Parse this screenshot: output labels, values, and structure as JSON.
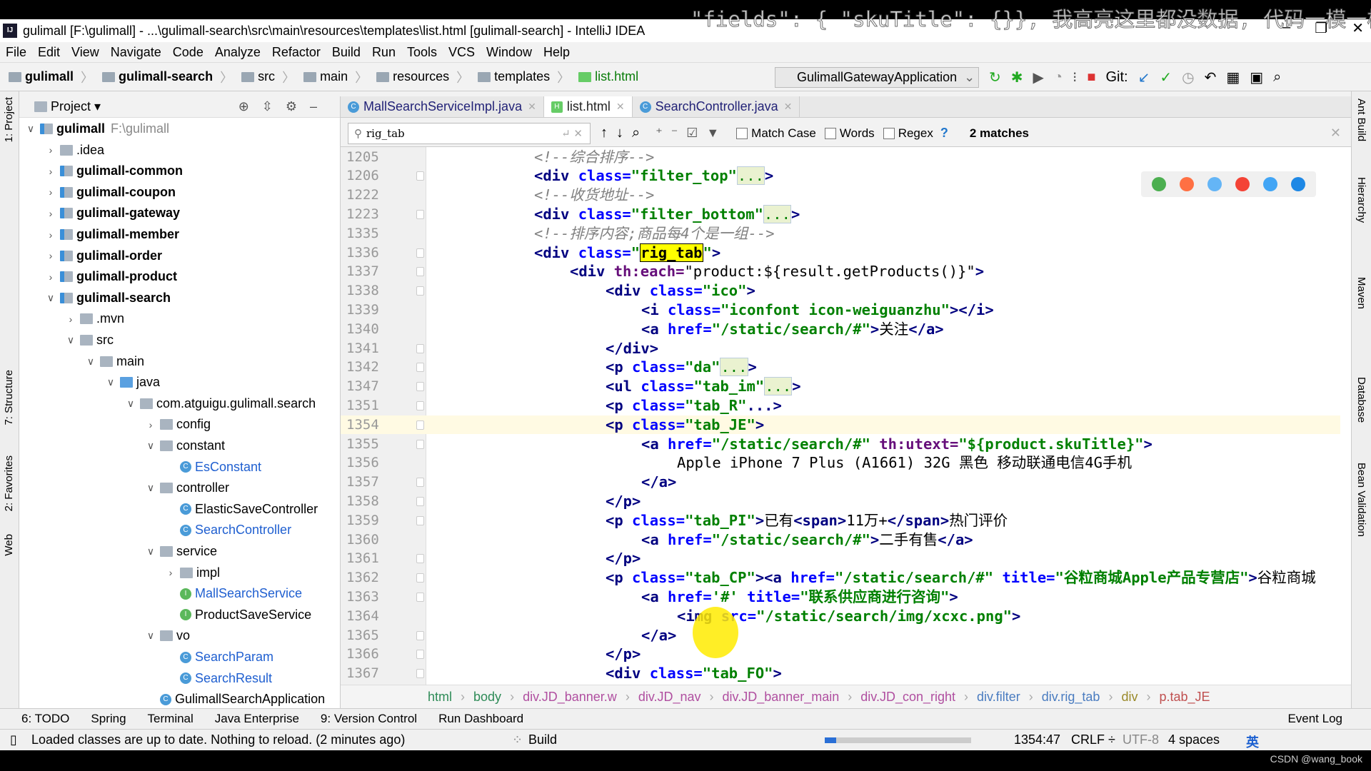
{
  "overlay_comment": "\"fields\": { \"skuTitle\": {}}, 我高亮这里都没数据, 代码一模一样",
  "title": "gulimall [F:\\gulimall] - ...\\gulimall-search\\src\\main\\resources\\templates\\list.html [gulimall-search] - IntelliJ IDEA",
  "menu": [
    "File",
    "Edit",
    "View",
    "Navigate",
    "Code",
    "Analyze",
    "Refactor",
    "Build",
    "Run",
    "Tools",
    "VCS",
    "Window",
    "Help"
  ],
  "nav": [
    "gulimall",
    "gulimall-search",
    "src",
    "main",
    "resources",
    "templates",
    "list.html"
  ],
  "run_config": "GulimallGatewayApplication",
  "git_label": "Git:",
  "project_panel": {
    "title": "Project ▾",
    "items": [
      {
        "label": "gulimall",
        "extra": "F:\\gulimall",
        "depth": 0,
        "state": "open",
        "icon": "module",
        "bold": true
      },
      {
        "label": ".idea",
        "depth": 1,
        "state": "closed",
        "icon": "folder"
      },
      {
        "label": "gulimall-common",
        "depth": 1,
        "state": "closed",
        "icon": "module",
        "bold": true
      },
      {
        "label": "gulimall-coupon",
        "depth": 1,
        "state": "closed",
        "icon": "module",
        "bold": true
      },
      {
        "label": "gulimall-gateway",
        "depth": 1,
        "state": "closed",
        "icon": "module",
        "bold": true
      },
      {
        "label": "gulimall-member",
        "depth": 1,
        "state": "closed",
        "icon": "module",
        "bold": true
      },
      {
        "label": "gulimall-order",
        "depth": 1,
        "state": "closed",
        "icon": "module",
        "bold": true
      },
      {
        "label": "gulimall-product",
        "depth": 1,
        "state": "closed",
        "icon": "module",
        "bold": true
      },
      {
        "label": "gulimall-search",
        "depth": 1,
        "state": "open",
        "icon": "module",
        "bold": true
      },
      {
        "label": ".mvn",
        "depth": 2,
        "state": "closed",
        "icon": "folder"
      },
      {
        "label": "src",
        "depth": 2,
        "state": "open",
        "icon": "folder"
      },
      {
        "label": "main",
        "depth": 3,
        "state": "open",
        "icon": "folder"
      },
      {
        "label": "java",
        "depth": 4,
        "state": "open",
        "icon": "src"
      },
      {
        "label": "com.atguigu.gulimall.search",
        "depth": 5,
        "state": "open",
        "icon": "pkg"
      },
      {
        "label": "config",
        "depth": 6,
        "state": "closed",
        "icon": "pkg"
      },
      {
        "label": "constant",
        "depth": 6,
        "state": "open",
        "icon": "pkg"
      },
      {
        "label": "EsConstant",
        "depth": 7,
        "icon": "cls",
        "modified": true
      },
      {
        "label": "controller",
        "depth": 6,
        "state": "open",
        "icon": "pkg"
      },
      {
        "label": "ElasticSaveController",
        "depth": 7,
        "icon": "cls"
      },
      {
        "label": "SearchController",
        "depth": 7,
        "icon": "cls",
        "modified": true
      },
      {
        "label": "service",
        "depth": 6,
        "state": "open",
        "icon": "pkg"
      },
      {
        "label": "impl",
        "depth": 7,
        "state": "closed",
        "icon": "pkg"
      },
      {
        "label": "MallSearchService",
        "depth": 7,
        "icon": "intf",
        "modified": true
      },
      {
        "label": "ProductSaveService",
        "depth": 7,
        "icon": "intf"
      },
      {
        "label": "vo",
        "depth": 6,
        "state": "open",
        "icon": "pkg"
      },
      {
        "label": "SearchParam",
        "depth": 7,
        "icon": "cls",
        "modified": true
      },
      {
        "label": "SearchResult",
        "depth": 7,
        "icon": "cls",
        "modified": true
      },
      {
        "label": "GulimallSearchApplication",
        "depth": 6,
        "icon": "cls"
      }
    ]
  },
  "tabs": [
    {
      "label": "MallSearchServiceImpl.java",
      "icon": "c"
    },
    {
      "label": "list.html",
      "icon": "html",
      "active": true
    },
    {
      "label": "SearchController.java",
      "icon": "c"
    }
  ],
  "find": {
    "query": "rig_tab",
    "match_case": "Match Case",
    "words": "Words",
    "regex": "Regex",
    "help": "?",
    "matches": "2 matches"
  },
  "code": [
    {
      "n": "1205",
      "i": 0,
      "t": [
        [
          "com",
          "<!--综合排序-->"
        ]
      ]
    },
    {
      "n": "1206",
      "i": 0,
      "f": 1,
      "t": [
        [
          "tag",
          "<div"
        ],
        [
          "attr",
          " class="
        ],
        [
          "val",
          "\"filter_top\""
        ],
        [
          "fold",
          "..."
        ],
        [
          "tag",
          ">"
        ]
      ]
    },
    {
      "n": "1222",
      "i": 0,
      "t": [
        [
          "com",
          "<!--收货地址-->"
        ]
      ]
    },
    {
      "n": "1223",
      "i": 0,
      "f": 1,
      "t": [
        [
          "tag",
          "<div"
        ],
        [
          "attr",
          " class="
        ],
        [
          "val",
          "\"filter_bottom\""
        ],
        [
          "fold",
          "..."
        ],
        [
          "tag",
          ">"
        ]
      ]
    },
    {
      "n": "1335",
      "i": 0,
      "t": [
        [
          "com",
          "<!--排序内容;商品每4个是一组-->"
        ]
      ]
    },
    {
      "n": "1336",
      "i": 0,
      "f": 1,
      "t": [
        [
          "tag",
          "<div"
        ],
        [
          "attr",
          " class="
        ],
        [
          "val",
          "\""
        ],
        [
          "hl",
          "rig_tab"
        ],
        [
          "val",
          "\""
        ],
        [
          "tag",
          ">"
        ]
      ]
    },
    {
      "n": "1337",
      "i": 1,
      "f": 1,
      "t": [
        [
          "tag",
          "<div"
        ],
        [
          "th",
          " th:each="
        ],
        [
          "expr",
          "\"product:${result.getProducts()}\""
        ],
        [
          "tag",
          ">"
        ]
      ]
    },
    {
      "n": "1338",
      "i": 2,
      "f": 1,
      "t": [
        [
          "tag",
          "<div"
        ],
        [
          "attr",
          " class="
        ],
        [
          "val",
          "\"ico\""
        ],
        [
          "tag",
          ">"
        ]
      ]
    },
    {
      "n": "1339",
      "i": 3,
      "t": [
        [
          "tag",
          "<i"
        ],
        [
          "attr",
          " class="
        ],
        [
          "val",
          "\"iconfont icon-weiguanzhu\""
        ],
        [
          "tag",
          "></i>"
        ]
      ]
    },
    {
      "n": "1340",
      "i": 3,
      "t": [
        [
          "tag",
          "<a"
        ],
        [
          "attr",
          " href="
        ],
        [
          "val",
          "\"/static/search/#\""
        ],
        [
          "tag",
          ">"
        ],
        [
          "text",
          "关注"
        ],
        [
          "tag",
          "</a>"
        ]
      ]
    },
    {
      "n": "1341",
      "i": 2,
      "f": 1,
      "t": [
        [
          "tag",
          "</div>"
        ]
      ]
    },
    {
      "n": "1342",
      "i": 2,
      "f": 1,
      "t": [
        [
          "tag",
          "<p"
        ],
        [
          "attr",
          " class="
        ],
        [
          "val",
          "\"da\""
        ],
        [
          "fold",
          "..."
        ],
        [
          "tag",
          ">"
        ]
      ]
    },
    {
      "n": "1347",
      "i": 2,
      "f": 1,
      "t": [
        [
          "tag",
          "<ul"
        ],
        [
          "attr",
          " class="
        ],
        [
          "val",
          "\"tab_im\""
        ],
        [
          "fold",
          "..."
        ],
        [
          "tag",
          ">"
        ]
      ]
    },
    {
      "n": "1351",
      "i": 2,
      "f": 1,
      "t": [
        [
          "tag",
          "<p"
        ],
        [
          "attr",
          " class="
        ],
        [
          "val",
          "\"tab_R\""
        ],
        [
          "tag",
          "...>"
        ]
      ]
    },
    {
      "n": "1354",
      "i": 2,
      "f": 1,
      "cur": true,
      "t": [
        [
          "tag",
          "<p"
        ],
        [
          "attr",
          " class="
        ],
        [
          "val",
          "\"tab_JE\""
        ],
        [
          "tag",
          ">"
        ]
      ]
    },
    {
      "n": "1355",
      "i": 3,
      "f": 1,
      "t": [
        [
          "tag",
          "<a"
        ],
        [
          "attr",
          " href="
        ],
        [
          "val",
          "\"/static/search/#\""
        ],
        [
          "th",
          " th:utext="
        ],
        [
          "val",
          "\"${product.skuTitle}\""
        ],
        [
          "tag",
          ">"
        ]
      ]
    },
    {
      "n": "1356",
      "i": 4,
      "t": [
        [
          "text",
          "Apple iPhone 7 Plus (A1661) 32G 黑色 移动联通电信4G手机"
        ]
      ]
    },
    {
      "n": "1357",
      "i": 3,
      "f": 1,
      "t": [
        [
          "tag",
          "</a>"
        ]
      ]
    },
    {
      "n": "1358",
      "i": 2,
      "f": 1,
      "t": [
        [
          "tag",
          "</p>"
        ]
      ]
    },
    {
      "n": "1359",
      "i": 2,
      "f": 1,
      "t": [
        [
          "tag",
          "<p"
        ],
        [
          "attr",
          " class="
        ],
        [
          "val",
          "\"tab_PI\""
        ],
        [
          "tag",
          ">"
        ],
        [
          "text",
          "已有"
        ],
        [
          "tag",
          "<span>"
        ],
        [
          "text",
          "11万+"
        ],
        [
          "tag",
          "</span>"
        ],
        [
          "text",
          "热门评价"
        ]
      ]
    },
    {
      "n": "1360",
      "i": 3,
      "t": [
        [
          "tag",
          "<a"
        ],
        [
          "attr",
          " href="
        ],
        [
          "val",
          "\"/static/search/#\""
        ],
        [
          "tag",
          ">"
        ],
        [
          "text",
          "二手有售"
        ],
        [
          "tag",
          "</a>"
        ]
      ]
    },
    {
      "n": "1361",
      "i": 2,
      "f": 1,
      "t": [
        [
          "tag",
          "</p>"
        ]
      ]
    },
    {
      "n": "1362",
      "i": 2,
      "f": 1,
      "t": [
        [
          "tag",
          "<p"
        ],
        [
          "attr",
          " class="
        ],
        [
          "val",
          "\"tab_CP\""
        ],
        [
          "tag",
          "><a"
        ],
        [
          "attr",
          " href="
        ],
        [
          "val",
          "\"/static/search/#\""
        ],
        [
          "attr",
          " title="
        ],
        [
          "val",
          "\"谷粒商城Apple产品专营店\""
        ],
        [
          "tag",
          ">"
        ],
        [
          "text",
          "谷粒商城"
        ]
      ]
    },
    {
      "n": "1363",
      "i": 3,
      "f": 1,
      "t": [
        [
          "tag",
          "<a"
        ],
        [
          "attr",
          " href="
        ],
        [
          "val",
          "'#'"
        ],
        [
          "attr",
          " title="
        ],
        [
          "val",
          "\"联系供应商进行咨询\""
        ],
        [
          "tag",
          ">"
        ]
      ]
    },
    {
      "n": "1364",
      "i": 4,
      "t": [
        [
          "tag",
          "<img"
        ],
        [
          "attr",
          " src="
        ],
        [
          "val",
          "\"/static/search/img/xcxc.png\""
        ],
        [
          "tag",
          ">"
        ]
      ]
    },
    {
      "n": "1365",
      "i": 3,
      "f": 1,
      "t": [
        [
          "tag",
          "</a>"
        ]
      ]
    },
    {
      "n": "1366",
      "i": 2,
      "f": 1,
      "t": [
        [
          "tag",
          "</p>"
        ]
      ]
    },
    {
      "n": "1367",
      "i": 2,
      "f": 1,
      "t": [
        [
          "tag",
          "<div"
        ],
        [
          "attr",
          " class="
        ],
        [
          "val",
          "\"tab_FO\""
        ],
        [
          "tag",
          ">"
        ]
      ]
    }
  ],
  "breadcrumb": [
    "html",
    "body",
    "div.JD_banner.w",
    "div.JD_nav",
    "div.JD_banner_main",
    "div.JD_con_right",
    "div.filter",
    "div.rig_tab",
    "div",
    "p.tab_JE"
  ],
  "tool_windows": [
    "6: TODO",
    "Spring",
    "Terminal",
    "Java Enterprise",
    "9: Version Control",
    "Run Dashboard"
  ],
  "event_log": "Event Log",
  "left_stripe": [
    "1: Project",
    "7: Structure",
    "2: Favorites",
    "Web"
  ],
  "right_stripe": [
    "Ant Build",
    "Hierarchy",
    "Maven",
    "Database",
    "Bean Validation"
  ],
  "status": {
    "message": "Loaded classes are up to date. Nothing to reload. (2 minutes ago)",
    "build": "Build",
    "position": "1354:47",
    "line_sep": "CRLF ÷",
    "encoding": "UTF-8",
    "indent": "4 spaces",
    "ime": "英"
  },
  "watermark": "CSDN @wang_book",
  "colors": {
    "tag": "#000080",
    "attr": "#0000ff",
    "value": "#008000",
    "comment": "#808080",
    "search_highlight": "#ffff00"
  }
}
